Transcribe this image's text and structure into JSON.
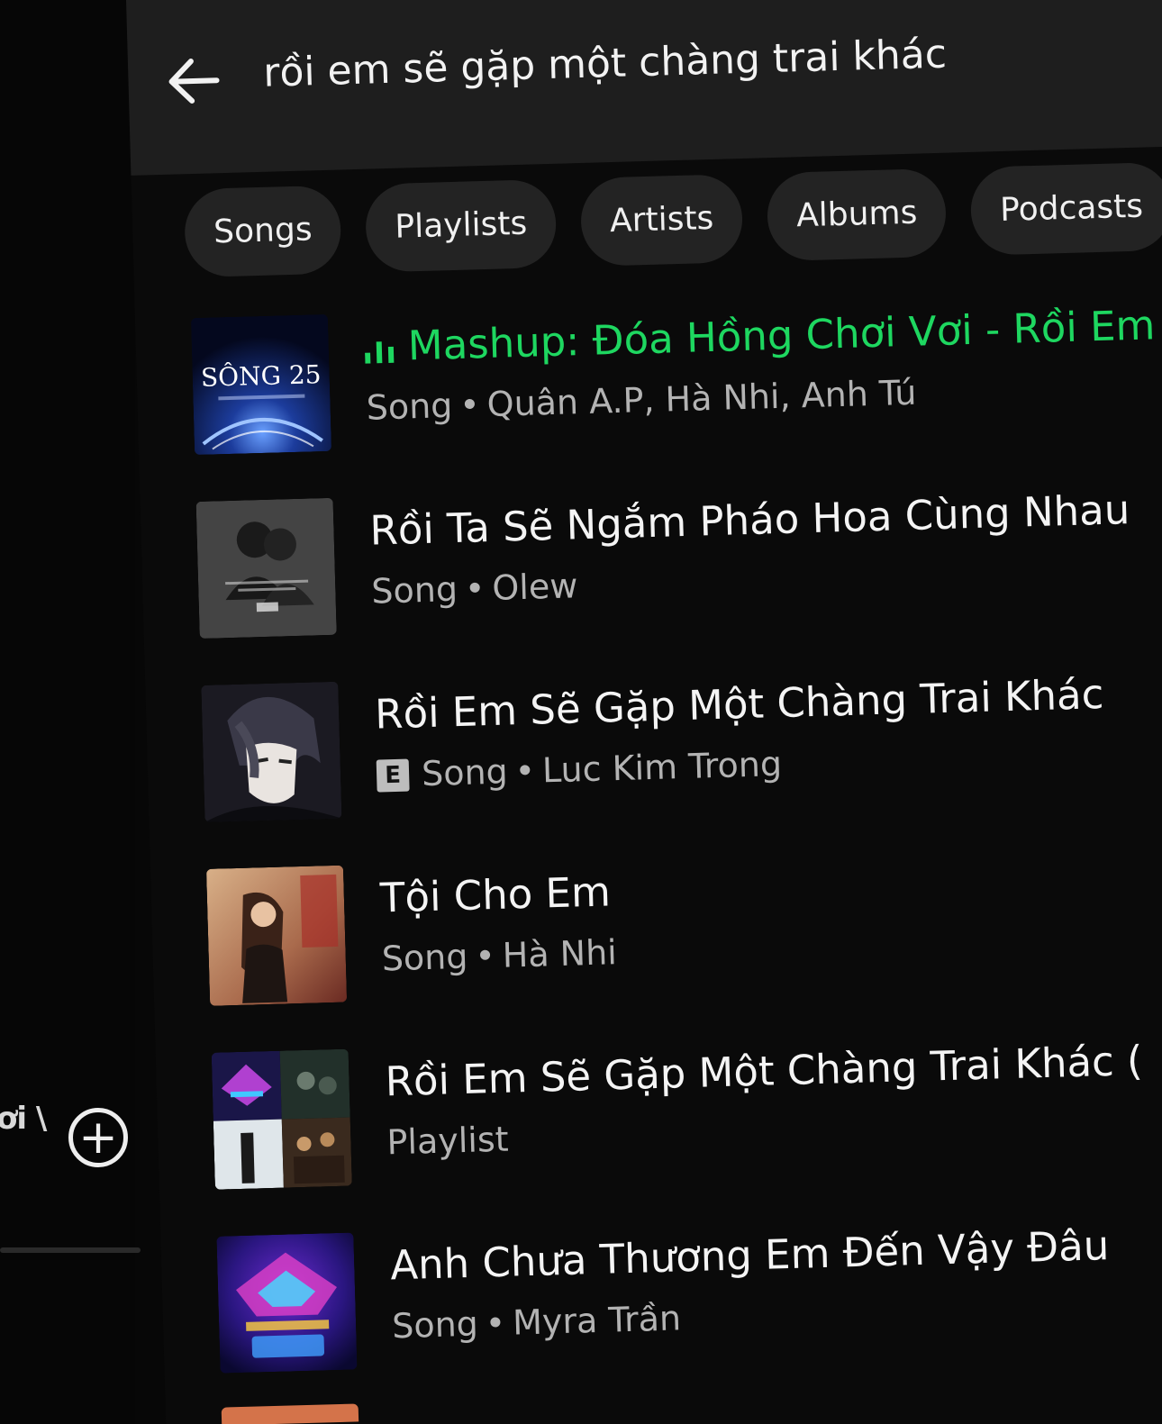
{
  "search": {
    "query": "rồi em sẽ gặp một chàng trai khác"
  },
  "filters": [
    "Songs",
    "Playlists",
    "Artists",
    "Albums",
    "Podcasts"
  ],
  "results": [
    {
      "title": "Mashup: Đóa Hồng Chơi Vơi - Rồi Em",
      "kind": "Song",
      "artists": "Quân A.P, Hà Nhi, Anh Tú",
      "playing": true,
      "explicit": false,
      "art_text": "SÔNG 25"
    },
    {
      "title": "Rồi Ta Sẽ Ngắm Pháo Hoa Cùng Nhau",
      "kind": "Song",
      "artists": "Olew",
      "playing": false,
      "explicit": false
    },
    {
      "title": "Rồi Em Sẽ Gặp Một Chàng Trai Khác",
      "kind": "Song",
      "artists": "Luc Kim Trong",
      "playing": false,
      "explicit": true,
      "explicit_label": "E"
    },
    {
      "title": "Tội Cho Em",
      "kind": "Song",
      "artists": "Hà Nhi",
      "playing": false,
      "explicit": false
    },
    {
      "title": "Rồi Em Sẽ Gặp Một Chàng Trai Khác (",
      "kind": "Playlist",
      "artists": "",
      "playing": false,
      "explicit": false
    },
    {
      "title": "Anh Chưa Thương Em Đến Vậy Đâu",
      "kind": "Song",
      "artists": "Myra Trần",
      "playing": false,
      "explicit": false
    }
  ],
  "left_panel": {
    "partial_label": "ơi \\"
  },
  "colors": {
    "accent": "#1ed760",
    "background": "#0a0a0a",
    "topbar": "#1e1e1e",
    "chip": "#232323",
    "subtext": "#b3b3b3"
  },
  "icons": {
    "back": "arrow-left-icon",
    "add": "plus-circle-icon",
    "now_playing": "equalizer-icon",
    "explicit": "explicit-badge-icon"
  }
}
